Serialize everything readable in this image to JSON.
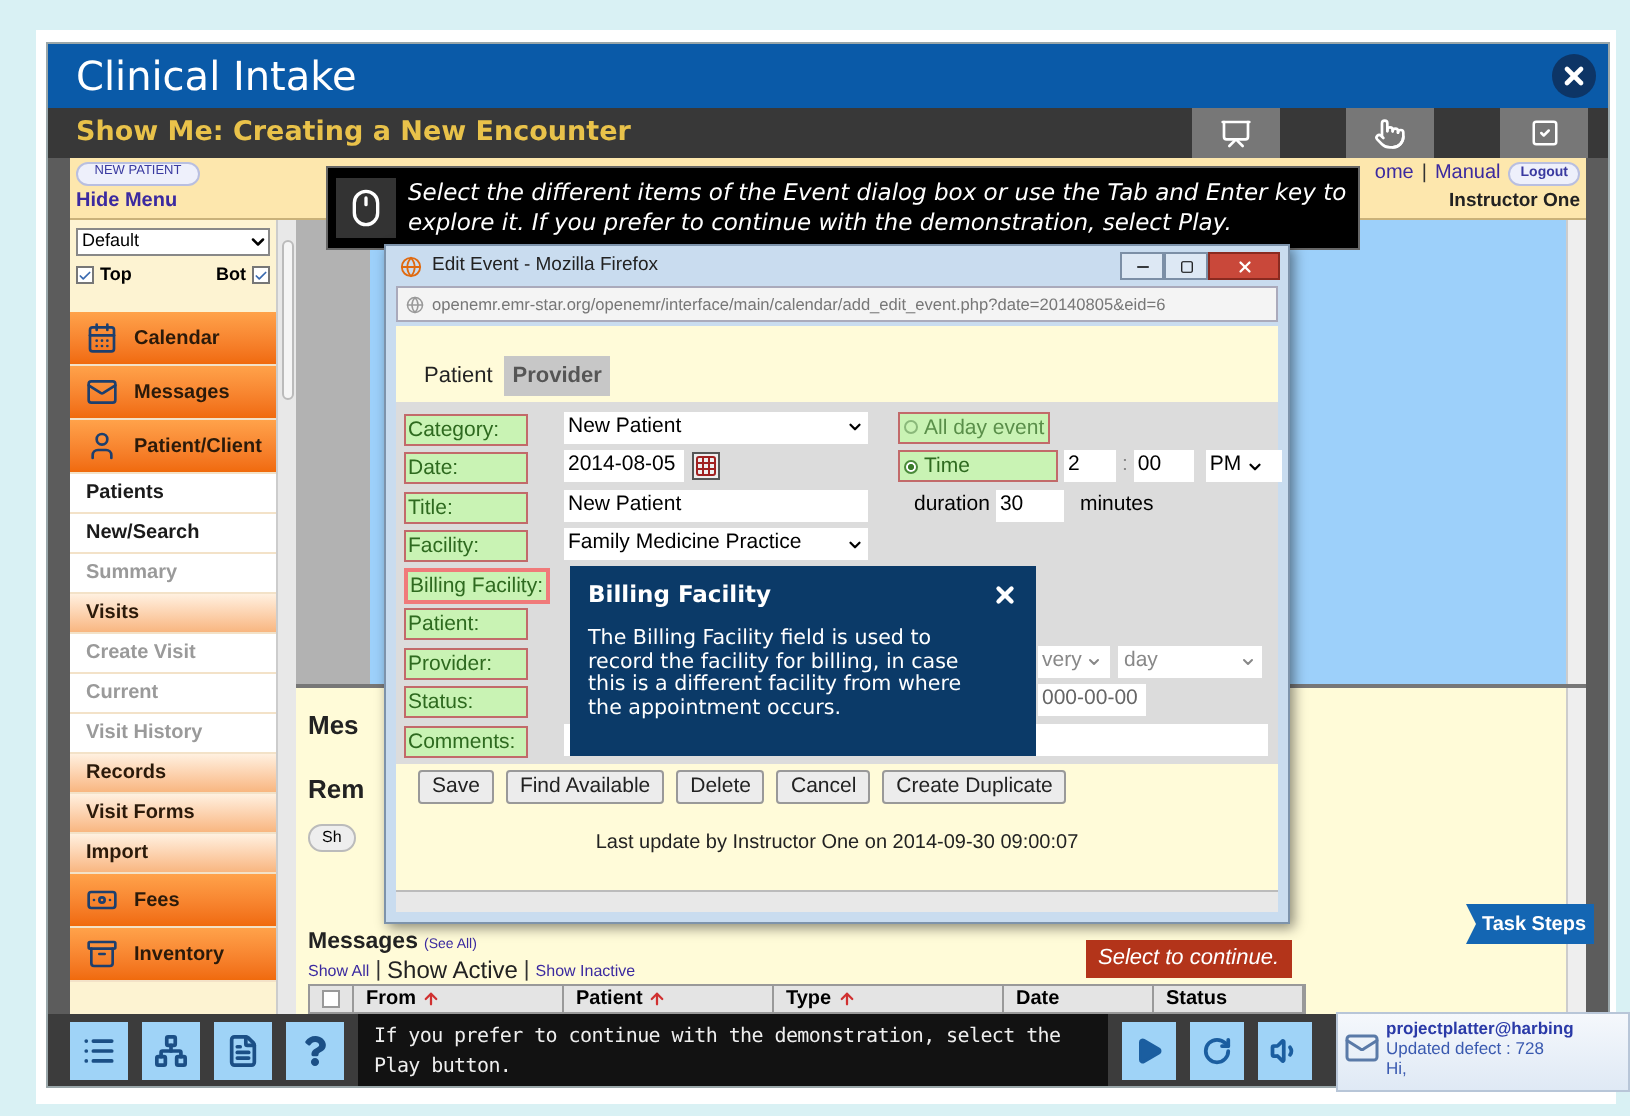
{
  "window": {
    "title": "Clinical Intake"
  },
  "lesson": {
    "title": "Show Me: Creating a New Encounter"
  },
  "header": {
    "new_patient": "NEW PATIENT",
    "hide_menu": "Hide Menu",
    "links": [
      "ome",
      "Manual"
    ],
    "separator": "|",
    "logout": "Logout",
    "user": "Instructor One"
  },
  "sidebar": {
    "select": "Default",
    "checks": [
      {
        "label": "Top",
        "checked": true
      },
      {
        "label": "Bot",
        "checked": true
      }
    ],
    "items": [
      {
        "label": "Calendar",
        "kind": "module",
        "disabled": false
      },
      {
        "label": "Messages",
        "kind": "module",
        "disabled": false
      },
      {
        "label": "Patient/Client",
        "kind": "module",
        "disabled": false
      },
      {
        "label": "Patients",
        "kind": "link",
        "disabled": false
      },
      {
        "label": "New/Search",
        "kind": "link",
        "disabled": false
      },
      {
        "label": "Summary",
        "kind": "link",
        "disabled": true
      },
      {
        "label": "Visits",
        "kind": "section",
        "disabled": false
      },
      {
        "label": "Create Visit",
        "kind": "link",
        "disabled": true
      },
      {
        "label": "Current",
        "kind": "link",
        "disabled": true
      },
      {
        "label": "Visit History",
        "kind": "link",
        "disabled": true
      },
      {
        "label": "Records",
        "kind": "section",
        "disabled": false
      },
      {
        "label": "Visit Forms",
        "kind": "section",
        "disabled": false
      },
      {
        "label": "Import",
        "kind": "section",
        "disabled": false
      },
      {
        "label": "Fees",
        "kind": "module",
        "disabled": false
      },
      {
        "label": "Inventory",
        "kind": "module",
        "disabled": false
      }
    ]
  },
  "background": {
    "headings": [
      "Mes",
      "Rem"
    ],
    "button": "Sh",
    "messages_title": "Messages",
    "see_all": "(See All)",
    "filters": [
      {
        "label": "Show All",
        "selected": false
      },
      {
        "label": "Show Active",
        "selected": true
      },
      {
        "label": "Show Inactive",
        "selected": false
      }
    ],
    "separator": "|",
    "select_all_checked": false,
    "columns": [
      "From",
      "Patient",
      "Type",
      "Date",
      "Status"
    ]
  },
  "instruction": "Select the different items of the Event dialog box or use the Tab and Enter key to explore it. If you prefer to continue with the demonstration, select Play.",
  "dialog": {
    "title": "Edit Event - Mozilla Firefox",
    "url": "openemr.emr-star.org/openemr/interface/main/calendar/add_edit_event.php?date=20140805&eid=6",
    "tabs": [
      {
        "label": "Patient",
        "selected": true
      },
      {
        "label": "Provider",
        "selected": false
      }
    ],
    "rows": [
      {
        "label": "Category:",
        "selected": false,
        "kind": "select",
        "value": "New Patient"
      },
      {
        "label": "Date:",
        "selected": false,
        "kind": "date",
        "value": "2014-08-05"
      },
      {
        "label": "Title:",
        "selected": false,
        "kind": "text",
        "value": "New Patient"
      },
      {
        "label": "Facility:",
        "selected": false,
        "kind": "select",
        "value": "Family Medicine Practice"
      },
      {
        "label": "Billing Facility:",
        "selected": true,
        "kind": "hidden"
      },
      {
        "label": "Patient:",
        "selected": false,
        "kind": "hidden"
      },
      {
        "label": "Provider:",
        "selected": false,
        "kind": "hidden"
      },
      {
        "label": "Status:",
        "selected": false,
        "kind": "hidden"
      },
      {
        "label": "Comments:",
        "selected": false,
        "kind": "wide"
      }
    ],
    "time_options": [
      {
        "label": "All day event",
        "selected": false
      },
      {
        "label": "Time",
        "selected": true
      }
    ],
    "hour": "2",
    "minute": "00",
    "separator": ":",
    "ampm": "PM",
    "duration_label": "duration",
    "duration": "30",
    "duration_unit": "minutes",
    "repeat": [
      "very",
      "day"
    ],
    "end_date": "000-00-00",
    "buttons": [
      "Save",
      "Find Available",
      "Delete",
      "Cancel",
      "Create Duplicate"
    ],
    "last_update": "Last update by Instructor One on 2014-09-30 09:00:07"
  },
  "tooltip": {
    "title": "Billing Facility",
    "text": "The Billing Facility field is used to record the facility for billing, in case this is a different facility from where the appointment occurs."
  },
  "task_steps": "Task Steps",
  "callout": "Select to continue.",
  "footer": {
    "text": "If you prefer to continue with the demonstration, select the Play button."
  },
  "notification": {
    "sender": "projectplatter@harbing",
    "subject": "Updated defect : 728",
    "body": "Hi,"
  }
}
